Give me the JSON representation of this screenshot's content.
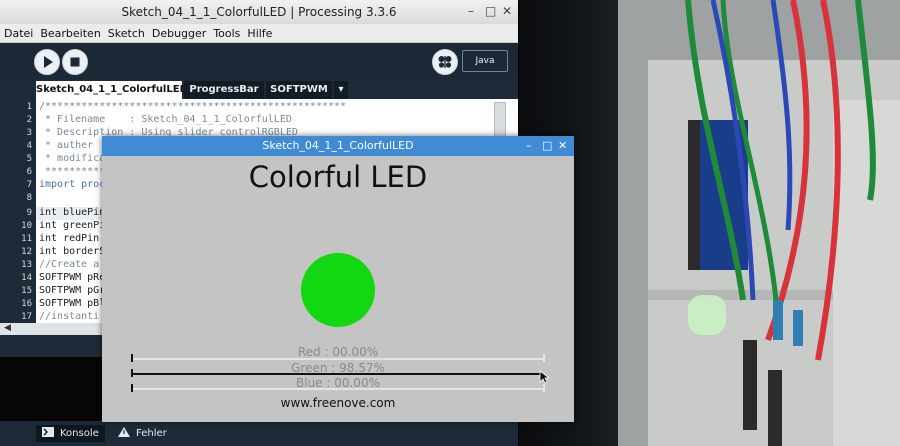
{
  "ide": {
    "window_title": "Sketch_04_1_1_ColorfulLED | Processing 3.3.6",
    "window_controls": {
      "minimize": "–",
      "maximize": "□",
      "close": "✕"
    },
    "menu": [
      "Datei",
      "Bearbeiten",
      "Sketch",
      "Debugger",
      "Tools",
      "Hilfe"
    ],
    "toolbar": {
      "run_icon": "play-icon",
      "stop_icon": "stop-icon",
      "debug_icon": "butterfly-icon",
      "mode": "Java"
    },
    "tabs": [
      "Sketch_04_1_1_ColorfulLED",
      "ProgressBar",
      "SOFTPWM"
    ],
    "tabs_menu": "▾",
    "line_numbers": [
      "1",
      "2",
      "3",
      "4",
      "5",
      "6",
      "7",
      "8",
      "9",
      "10",
      "11",
      "12",
      "13",
      "14",
      "15",
      "16",
      "17"
    ],
    "code": [
      "/**************************************************",
      " * Filename    : Sketch_04_1_1_ColorfulLED",
      " * Description : Using slider controlRGBLED",
      " * auther",
      " * modifica",
      " ************",
      "import proc",
      "",
      "int bluePin",
      "int greenPi",
      "int redPin",
      "int borderS",
      "//Create a",
      "SOFTPWM pRe",
      "SOFTPWM pGr",
      "SOFTPWM pBl",
      "//instanti"
    ],
    "bottom_tabs": [
      "Konsole",
      "Fehler"
    ]
  },
  "sketch": {
    "title": "Sketch_04_1_1_ColorfulLED",
    "controls": {
      "minimize": "–",
      "maximize": "□",
      "close": "✕"
    },
    "heading": "Colorful LED",
    "led_color": "#12d812",
    "sliders": [
      {
        "label": "Red : 00.00%",
        "value": 0.0
      },
      {
        "label": "Green : 98.57%",
        "value": 0.9857
      },
      {
        "label": "Blue : 00.00%",
        "value": 0.0
      }
    ],
    "footer": "www.freenove.com"
  }
}
